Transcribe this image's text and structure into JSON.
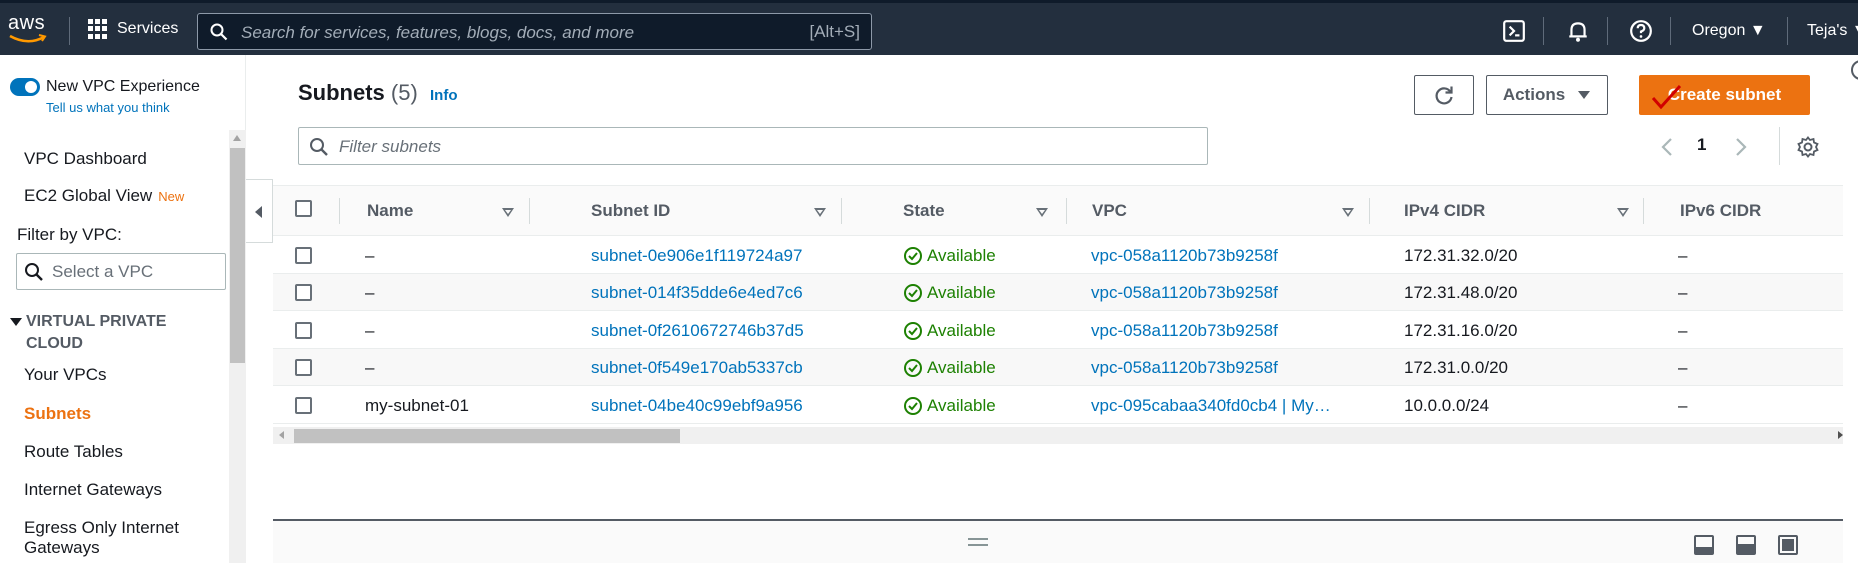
{
  "topnav": {
    "logo_text": "aws",
    "services_label": "Services",
    "search_placeholder": "Search for services, features, blogs, docs, and more",
    "search_shortcut": "[Alt+S]",
    "region_label": "Oregon ▼",
    "user_label": "Teja's ▼"
  },
  "sidebar": {
    "new_vpc_label": "New VPC Experience",
    "tell_us_label": "Tell us what you think",
    "vpc_dashboard": "VPC Dashboard",
    "ec2_global_view": "EC2 Global View",
    "new_badge": "New",
    "filter_label": "Filter by VPC:",
    "select_placeholder": "Select a VPC",
    "section_title_1": "VIRTUAL PRIVATE",
    "section_title_2": "CLOUD",
    "items": [
      {
        "label": "Your VPCs"
      },
      {
        "label": "Subnets"
      },
      {
        "label": "Route Tables"
      },
      {
        "label": "Internet Gateways"
      },
      {
        "label": "Egress Only Internet"
      },
      {
        "label": "Gateways"
      }
    ]
  },
  "main": {
    "title": "Subnets",
    "count": "(5)",
    "info_label": "Info",
    "actions_label": "Actions",
    "create_label": "Create subnet",
    "filter_placeholder": "Filter subnets",
    "page_number": "1",
    "columns": [
      "Name",
      "Subnet ID",
      "State",
      "VPC",
      "IPv4 CIDR",
      "IPv6 CIDR"
    ],
    "rows": [
      {
        "name": "–",
        "subnet_id": "subnet-0e906e1f119724a97",
        "state": "Available",
        "vpc": "vpc-058a1120b73b9258f",
        "ipv4": "172.31.32.0/20",
        "ipv6": "–"
      },
      {
        "name": "–",
        "subnet_id": "subnet-014f35dde6e4ed7c6",
        "state": "Available",
        "vpc": "vpc-058a1120b73b9258f",
        "ipv4": "172.31.48.0/20",
        "ipv6": "–"
      },
      {
        "name": "–",
        "subnet_id": "subnet-0f2610672746b37d5",
        "state": "Available",
        "vpc": "vpc-058a1120b73b9258f",
        "ipv4": "172.31.16.0/20",
        "ipv6": "–"
      },
      {
        "name": "–",
        "subnet_id": "subnet-0f549e170ab5337cb",
        "state": "Available",
        "vpc": "vpc-058a1120b73b9258f",
        "ipv4": "172.31.0.0/20",
        "ipv6": "–"
      },
      {
        "name": "my-subnet-01",
        "subnet_id": "subnet-04be40c99ebf9a956",
        "state": "Available",
        "vpc": "vpc-095cabaa340fd0cb4 | My…",
        "ipv4": "10.0.0.0/24",
        "ipv6": "–"
      }
    ]
  },
  "colors": {
    "nav_bg": "#232f3e",
    "accent_orange": "#ec7211",
    "link_blue": "#0073bb",
    "success_green": "#1d8102"
  }
}
